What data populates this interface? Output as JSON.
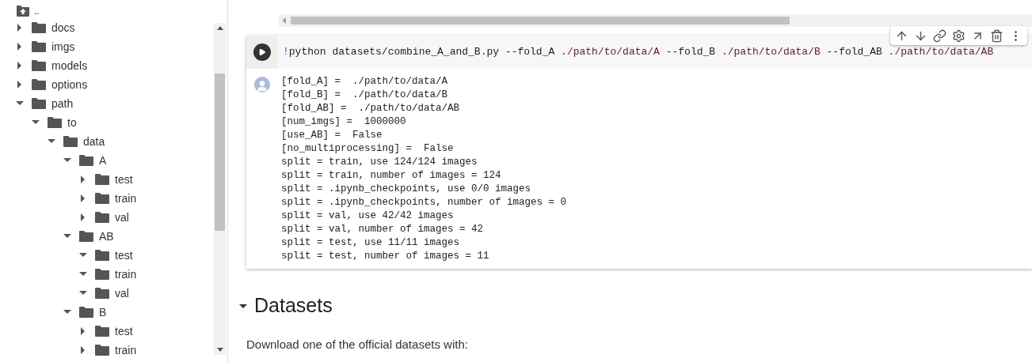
{
  "file_tree": {
    "parent_label": "..",
    "items": [
      {
        "name": "docs",
        "expanded": false
      },
      {
        "name": "imgs",
        "expanded": false
      },
      {
        "name": "models",
        "expanded": false
      },
      {
        "name": "options",
        "expanded": false
      },
      {
        "name": "path",
        "expanded": true,
        "children": [
          {
            "name": "to",
            "expanded": true,
            "children": [
              {
                "name": "data",
                "expanded": true,
                "children": [
                  {
                    "name": "A",
                    "expanded": true,
                    "children": [
                      {
                        "name": "test",
                        "expanded": false
                      },
                      {
                        "name": "train",
                        "expanded": false
                      },
                      {
                        "name": "val",
                        "expanded": false
                      }
                    ]
                  },
                  {
                    "name": "AB",
                    "expanded": true,
                    "children": [
                      {
                        "name": "test",
                        "expanded": true
                      },
                      {
                        "name": "train",
                        "expanded": true
                      },
                      {
                        "name": "val",
                        "expanded": true
                      }
                    ]
                  },
                  {
                    "name": "B",
                    "expanded": true,
                    "children": [
                      {
                        "name": "test",
                        "expanded": false
                      },
                      {
                        "name": "train",
                        "expanded": false
                      }
                    ]
                  }
                ]
              }
            ]
          }
        ]
      }
    ]
  },
  "code_cell": {
    "tokens": [
      {
        "kind": "magic",
        "text": "!"
      },
      {
        "kind": "plain",
        "text": "python datasets/combine_A_and_B.py --fold_A "
      },
      {
        "kind": "path",
        "text": "./path/to/data/A"
      },
      {
        "kind": "plain",
        "text": " --fold_B "
      },
      {
        "kind": "path",
        "text": "./path/to/data/B"
      },
      {
        "kind": "plain",
        "text": " --fold_AB "
      },
      {
        "kind": "path",
        "text": "./path/to/data/AB"
      }
    ],
    "output": [
      "[fold_A] =  ./path/to/data/A",
      "[fold_B] =  ./path/to/data/B",
      "[fold_AB] =  ./path/to/data/AB",
      "[num_imgs] =  1000000",
      "[use_AB] =  False",
      "[no_multiprocessing] =  False",
      "split = train, use 124/124 images",
      "split = train, number of images = 124",
      "split = .ipynb_checkpoints, use 0/0 images",
      "split = .ipynb_checkpoints, number of images = 0",
      "split = val, use 42/42 images",
      "split = val, number of images = 42",
      "split = test, use 11/11 images",
      "split = test, number of images = 11"
    ]
  },
  "section": {
    "title": "Datasets",
    "expanded": true,
    "text": "Download one of the official datasets with:"
  }
}
